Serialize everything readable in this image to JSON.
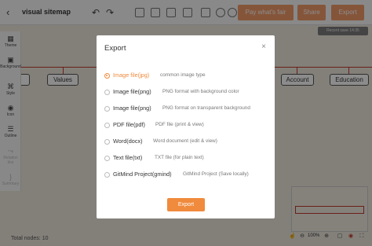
{
  "header": {
    "title": "visual sitemap",
    "pay_label": "Pay what's fair",
    "share_label": "Share",
    "export_label": "Export",
    "save_status": "Recent save 14:35"
  },
  "sidebar": {
    "items": [
      {
        "label": "Theme",
        "icon": "grid-icon"
      },
      {
        "label": "Background",
        "icon": "image-icon"
      },
      {
        "label": "Style",
        "icon": "style-icon"
      },
      {
        "label": "Icon",
        "icon": "target-icon"
      },
      {
        "label": "Outline",
        "icon": "list-icon"
      },
      {
        "label": "Relation line",
        "icon": "relation-icon"
      },
      {
        "label": "Summary",
        "icon": "summary-icon"
      }
    ]
  },
  "map": {
    "nodes": [
      "ut",
      "Values",
      "Account",
      "Education"
    ]
  },
  "footer": {
    "total_nodes": "Total nodes: 10",
    "zoom": "100%"
  },
  "modal": {
    "title": "Export",
    "button_label": "Export",
    "options": [
      {
        "name": "Image file(jpg)",
        "desc": "common image type",
        "selected": true
      },
      {
        "name": "Image file(png)",
        "desc": "PNG format with background color",
        "selected": false
      },
      {
        "name": "Image file(png)",
        "desc": "PNG format on transparent background",
        "selected": false
      },
      {
        "name": "PDF file(pdf)",
        "desc": "PDF file (print & view)",
        "selected": false
      },
      {
        "name": "Word(docx)",
        "desc": "Word document (edit & view)",
        "selected": false
      },
      {
        "name": "Text file(txt)",
        "desc": "TXT file (for plain text)",
        "selected": false
      },
      {
        "name": "GitMind Project(gmind)",
        "desc": "GitMind Project (Save locally)",
        "selected": false
      }
    ]
  },
  "colors": {
    "accent": "#f08a3c",
    "button_bg": "#f39c6b",
    "line": "#c0392b"
  }
}
